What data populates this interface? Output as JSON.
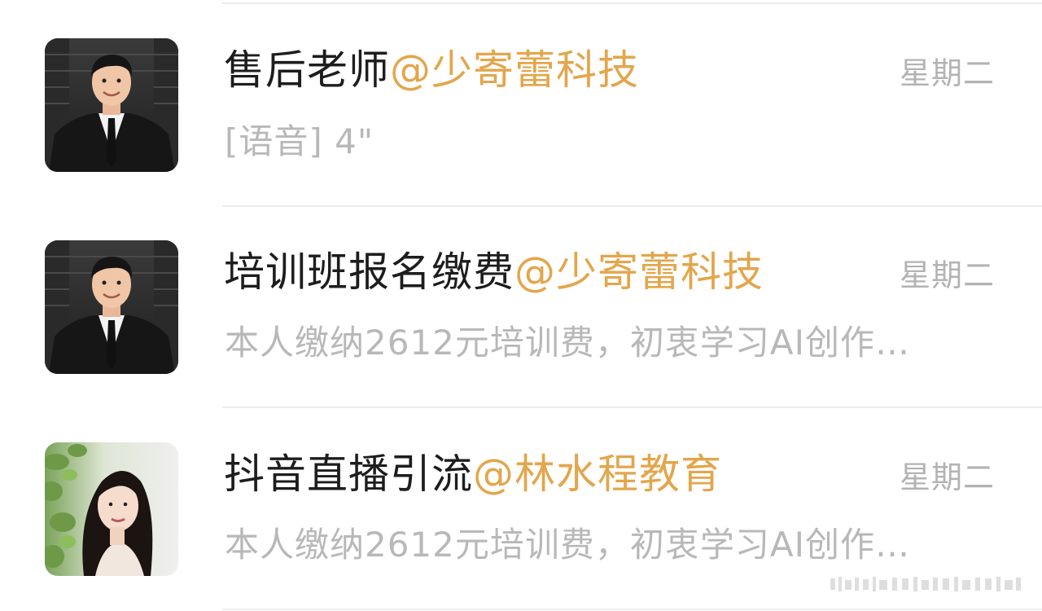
{
  "chats": [
    {
      "name": "售后老师",
      "org": "@少寄蕾科技",
      "time": "星期二",
      "preview": "[语音] 4\"",
      "avatar": "man-in-suit-avatar"
    },
    {
      "name": "培训班报名缴费",
      "org": "@少寄蕾科技",
      "time": "星期二",
      "preview": "本人缴纳2612元培训费，初衷学习AI创作…",
      "avatar": "man-in-suit-avatar"
    },
    {
      "name": "抖音直播引流",
      "org": "@林水程教育",
      "time": "星期二",
      "preview": "本人缴纳2612元培训费，初衷学习AI创作…",
      "avatar": "woman-portrait-avatar"
    }
  ],
  "colors": {
    "org_accent": "#e3a64b",
    "name_text": "#1d1d1d",
    "secondary_text": "#b3b3b3",
    "divider": "#ececec"
  }
}
